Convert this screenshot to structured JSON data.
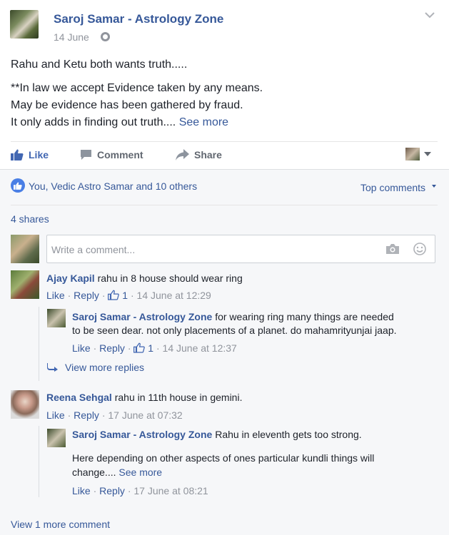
{
  "post": {
    "author": "Saroj Samar - Astrology Zone",
    "date": "14 June",
    "lines": [
      "Rahu and Ketu both wants truth.....",
      "**In law we accept Evidence taken by any means.",
      "May be evidence has been gathered by fraud.",
      "It only adds in finding out truth...."
    ],
    "see_more": "See more"
  },
  "actions": {
    "like": "Like",
    "comment": "Comment",
    "share": "Share"
  },
  "reactions": {
    "text": "You, Vedic Astro Samar and 10 others",
    "top_comments": "Top comments",
    "shares": "4 shares"
  },
  "comment_input": {
    "placeholder": "Write a comment..."
  },
  "comments": [
    {
      "author": "Ajay Kapil",
      "text": "rahu in 8 house should wear ring",
      "like": "Like",
      "reply": "Reply",
      "likes": "1",
      "time": "14 June at 12:29",
      "replies": [
        {
          "author": "Saroj Samar - Astrology Zone",
          "text_first": "for wearing ring many things are needed",
          "text_second": "to be seen dear. not only placements of a planet. do mahamrityunjai jaap.",
          "like": "Like",
          "reply": "Reply",
          "likes": "1",
          "time": "14 June at 12:37"
        }
      ],
      "view_more_replies": "View more replies"
    },
    {
      "author": "Reena Sehgal",
      "text": "rahu in 11th house in gemini.",
      "like": "Like",
      "reply": "Reply",
      "time": "17 June at 07:32",
      "replies": [
        {
          "author": "Saroj Samar - Astrology Zone",
          "text_first": "Rahu in eleventh gets too strong.",
          "text_second": "Here depending on other aspects of ones particular kundli things will",
          "text_third": "change....",
          "see_more": "See more",
          "like": "Like",
          "reply": "Reply",
          "time": "17 June at 08:21"
        }
      ]
    }
  ],
  "view_more_comments": "View 1 more comment",
  "colors": {
    "link": "#365899",
    "like_active": "#4267b2",
    "muted": "#90949c",
    "text": "#1d2129",
    "reaction_bg": "#f6f7f9"
  },
  "icons": {
    "globe": "globe-icon",
    "chevron": "chevron-down-icon",
    "like": "thumbs-up-icon",
    "comment": "comment-bubble-icon",
    "share": "share-arrow-icon",
    "camera": "camera-icon",
    "smiley": "smiley-icon",
    "reply_arrow": "reply-arrow-icon"
  }
}
